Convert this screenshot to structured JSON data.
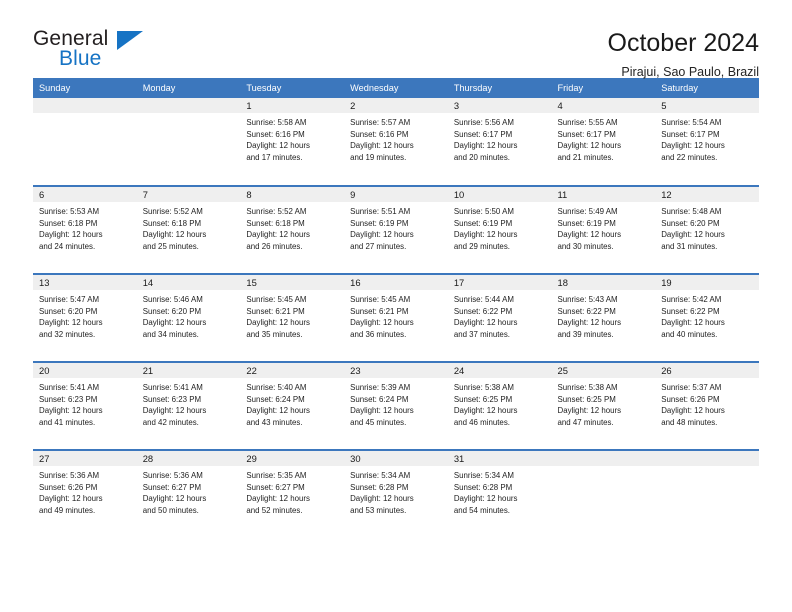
{
  "brand": {
    "name_top": "General",
    "name_bottom": "Blue",
    "accent_color": "#1673c4",
    "triangle_icon": "triangle-icon"
  },
  "header": {
    "title": "October 2024",
    "subtitle": "Pirajui, Sao Paulo, Brazil"
  },
  "theme": {
    "header_blue": "#3c77bd",
    "daynum_gray": "#efefef",
    "text": "#1f1f1f"
  },
  "weekdays": [
    "Sunday",
    "Monday",
    "Tuesday",
    "Wednesday",
    "Thursday",
    "Friday",
    "Saturday"
  ],
  "weeks": [
    [
      {
        "day": "",
        "sunrise": "",
        "sunset": "",
        "daylight1": "",
        "daylight2": ""
      },
      {
        "day": "",
        "sunrise": "",
        "sunset": "",
        "daylight1": "",
        "daylight2": ""
      },
      {
        "day": "1",
        "sunrise": "Sunrise: 5:58 AM",
        "sunset": "Sunset: 6:16 PM",
        "daylight1": "Daylight: 12 hours",
        "daylight2": "and 17 minutes."
      },
      {
        "day": "2",
        "sunrise": "Sunrise: 5:57 AM",
        "sunset": "Sunset: 6:16 PM",
        "daylight1": "Daylight: 12 hours",
        "daylight2": "and 19 minutes."
      },
      {
        "day": "3",
        "sunrise": "Sunrise: 5:56 AM",
        "sunset": "Sunset: 6:17 PM",
        "daylight1": "Daylight: 12 hours",
        "daylight2": "and 20 minutes."
      },
      {
        "day": "4",
        "sunrise": "Sunrise: 5:55 AM",
        "sunset": "Sunset: 6:17 PM",
        "daylight1": "Daylight: 12 hours",
        "daylight2": "and 21 minutes."
      },
      {
        "day": "5",
        "sunrise": "Sunrise: 5:54 AM",
        "sunset": "Sunset: 6:17 PM",
        "daylight1": "Daylight: 12 hours",
        "daylight2": "and 22 minutes."
      }
    ],
    [
      {
        "day": "6",
        "sunrise": "Sunrise: 5:53 AM",
        "sunset": "Sunset: 6:18 PM",
        "daylight1": "Daylight: 12 hours",
        "daylight2": "and 24 minutes."
      },
      {
        "day": "7",
        "sunrise": "Sunrise: 5:52 AM",
        "sunset": "Sunset: 6:18 PM",
        "daylight1": "Daylight: 12 hours",
        "daylight2": "and 25 minutes."
      },
      {
        "day": "8",
        "sunrise": "Sunrise: 5:52 AM",
        "sunset": "Sunset: 6:18 PM",
        "daylight1": "Daylight: 12 hours",
        "daylight2": "and 26 minutes."
      },
      {
        "day": "9",
        "sunrise": "Sunrise: 5:51 AM",
        "sunset": "Sunset: 6:19 PM",
        "daylight1": "Daylight: 12 hours",
        "daylight2": "and 27 minutes."
      },
      {
        "day": "10",
        "sunrise": "Sunrise: 5:50 AM",
        "sunset": "Sunset: 6:19 PM",
        "daylight1": "Daylight: 12 hours",
        "daylight2": "and 29 minutes."
      },
      {
        "day": "11",
        "sunrise": "Sunrise: 5:49 AM",
        "sunset": "Sunset: 6:19 PM",
        "daylight1": "Daylight: 12 hours",
        "daylight2": "and 30 minutes."
      },
      {
        "day": "12",
        "sunrise": "Sunrise: 5:48 AM",
        "sunset": "Sunset: 6:20 PM",
        "daylight1": "Daylight: 12 hours",
        "daylight2": "and 31 minutes."
      }
    ],
    [
      {
        "day": "13",
        "sunrise": "Sunrise: 5:47 AM",
        "sunset": "Sunset: 6:20 PM",
        "daylight1": "Daylight: 12 hours",
        "daylight2": "and 32 minutes."
      },
      {
        "day": "14",
        "sunrise": "Sunrise: 5:46 AM",
        "sunset": "Sunset: 6:20 PM",
        "daylight1": "Daylight: 12 hours",
        "daylight2": "and 34 minutes."
      },
      {
        "day": "15",
        "sunrise": "Sunrise: 5:45 AM",
        "sunset": "Sunset: 6:21 PM",
        "daylight1": "Daylight: 12 hours",
        "daylight2": "and 35 minutes."
      },
      {
        "day": "16",
        "sunrise": "Sunrise: 5:45 AM",
        "sunset": "Sunset: 6:21 PM",
        "daylight1": "Daylight: 12 hours",
        "daylight2": "and 36 minutes."
      },
      {
        "day": "17",
        "sunrise": "Sunrise: 5:44 AM",
        "sunset": "Sunset: 6:22 PM",
        "daylight1": "Daylight: 12 hours",
        "daylight2": "and 37 minutes."
      },
      {
        "day": "18",
        "sunrise": "Sunrise: 5:43 AM",
        "sunset": "Sunset: 6:22 PM",
        "daylight1": "Daylight: 12 hours",
        "daylight2": "and 39 minutes."
      },
      {
        "day": "19",
        "sunrise": "Sunrise: 5:42 AM",
        "sunset": "Sunset: 6:22 PM",
        "daylight1": "Daylight: 12 hours",
        "daylight2": "and 40 minutes."
      }
    ],
    [
      {
        "day": "20",
        "sunrise": "Sunrise: 5:41 AM",
        "sunset": "Sunset: 6:23 PM",
        "daylight1": "Daylight: 12 hours",
        "daylight2": "and 41 minutes."
      },
      {
        "day": "21",
        "sunrise": "Sunrise: 5:41 AM",
        "sunset": "Sunset: 6:23 PM",
        "daylight1": "Daylight: 12 hours",
        "daylight2": "and 42 minutes."
      },
      {
        "day": "22",
        "sunrise": "Sunrise: 5:40 AM",
        "sunset": "Sunset: 6:24 PM",
        "daylight1": "Daylight: 12 hours",
        "daylight2": "and 43 minutes."
      },
      {
        "day": "23",
        "sunrise": "Sunrise: 5:39 AM",
        "sunset": "Sunset: 6:24 PM",
        "daylight1": "Daylight: 12 hours",
        "daylight2": "and 45 minutes."
      },
      {
        "day": "24",
        "sunrise": "Sunrise: 5:38 AM",
        "sunset": "Sunset: 6:25 PM",
        "daylight1": "Daylight: 12 hours",
        "daylight2": "and 46 minutes."
      },
      {
        "day": "25",
        "sunrise": "Sunrise: 5:38 AM",
        "sunset": "Sunset: 6:25 PM",
        "daylight1": "Daylight: 12 hours",
        "daylight2": "and 47 minutes."
      },
      {
        "day": "26",
        "sunrise": "Sunrise: 5:37 AM",
        "sunset": "Sunset: 6:26 PM",
        "daylight1": "Daylight: 12 hours",
        "daylight2": "and 48 minutes."
      }
    ],
    [
      {
        "day": "27",
        "sunrise": "Sunrise: 5:36 AM",
        "sunset": "Sunset: 6:26 PM",
        "daylight1": "Daylight: 12 hours",
        "daylight2": "and 49 minutes."
      },
      {
        "day": "28",
        "sunrise": "Sunrise: 5:36 AM",
        "sunset": "Sunset: 6:27 PM",
        "daylight1": "Daylight: 12 hours",
        "daylight2": "and 50 minutes."
      },
      {
        "day": "29",
        "sunrise": "Sunrise: 5:35 AM",
        "sunset": "Sunset: 6:27 PM",
        "daylight1": "Daylight: 12 hours",
        "daylight2": "and 52 minutes."
      },
      {
        "day": "30",
        "sunrise": "Sunrise: 5:34 AM",
        "sunset": "Sunset: 6:28 PM",
        "daylight1": "Daylight: 12 hours",
        "daylight2": "and 53 minutes."
      },
      {
        "day": "31",
        "sunrise": "Sunrise: 5:34 AM",
        "sunset": "Sunset: 6:28 PM",
        "daylight1": "Daylight: 12 hours",
        "daylight2": "and 54 minutes."
      },
      {
        "day": "",
        "sunrise": "",
        "sunset": "",
        "daylight1": "",
        "daylight2": ""
      },
      {
        "day": "",
        "sunrise": "",
        "sunset": "",
        "daylight1": "",
        "daylight2": ""
      }
    ]
  ]
}
